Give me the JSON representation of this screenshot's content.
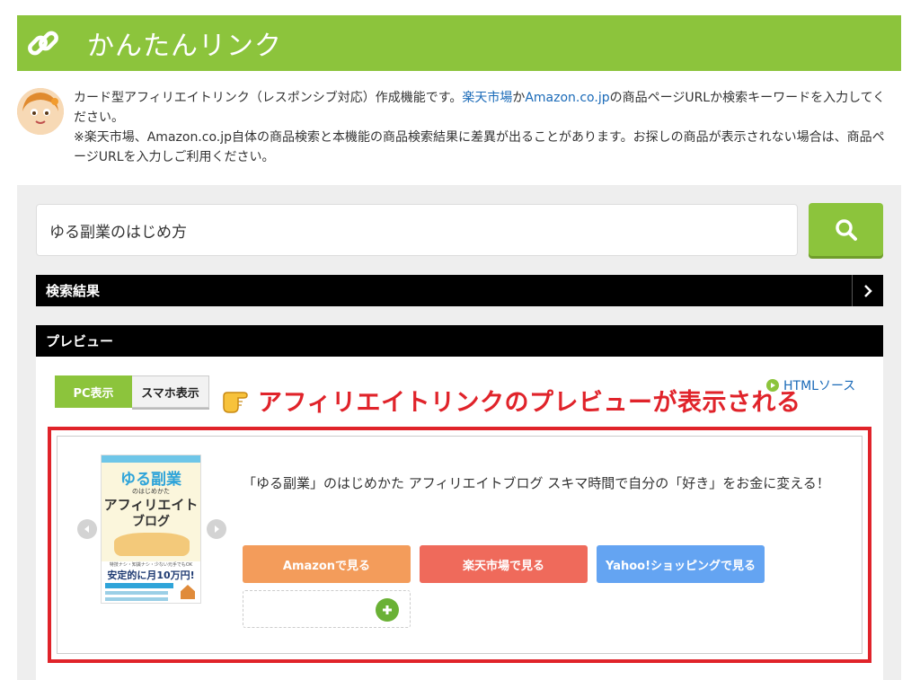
{
  "header": {
    "title": "かんたんリンク",
    "accent_color": "#8cc43c",
    "icon": "link-icon"
  },
  "intro": {
    "avatar": "avatar-girl",
    "line1_a": "カード型アフィリエイトリンク（レスポンシブ対応）作成機能です。",
    "rakuten": "楽天市場",
    "ka": "か",
    "amazon": "Amazon.co.jp",
    "line1_b": "の商品ページURLか検索キーワードを入力してください。",
    "line2": "※楽天市場、Amazon.co.jp自体の商品検索と本機能の商品検索結果に差異が出ることがあります。お探しの商品が表示されない場合は、商品ページURLを入力しご利用ください。"
  },
  "search": {
    "value": "ゆる副業のはじめ方",
    "button_icon": "search-icon"
  },
  "sections": {
    "results": "検索結果",
    "preview": "プレビュー"
  },
  "tabs": {
    "pc": "PC表示",
    "sp": "スマホ表示",
    "active": "pc"
  },
  "annotation": {
    "text": "アフィリエイトリンクのプレビューが表示される",
    "icon": "pointing-hand-icon",
    "color": "#e0232a"
  },
  "html_source": {
    "label": "HTMLソース"
  },
  "product": {
    "title": "「ゆる副業」のはじめかた アフィリエイトブログ スキマ時間で自分の「好き」をお金に変える！",
    "cover": {
      "t1": "ゆる副業",
      "t2": "のはじめかた",
      "t3": "アフィリエイト",
      "t4": "ブログ",
      "t5": "特技ナシ・知識ナシ・少ない元手でもOK",
      "t6": "安定的に月10万円!"
    },
    "buttons": {
      "amazon": "Amazonで見る",
      "rakuten": "楽天市場で見る",
      "yahoo": "Yahoo!ショッピングで見る"
    },
    "button_colors": {
      "amazon": "#f39c5b",
      "rakuten": "#ef6a5b",
      "yahoo": "#64a4f2"
    }
  }
}
